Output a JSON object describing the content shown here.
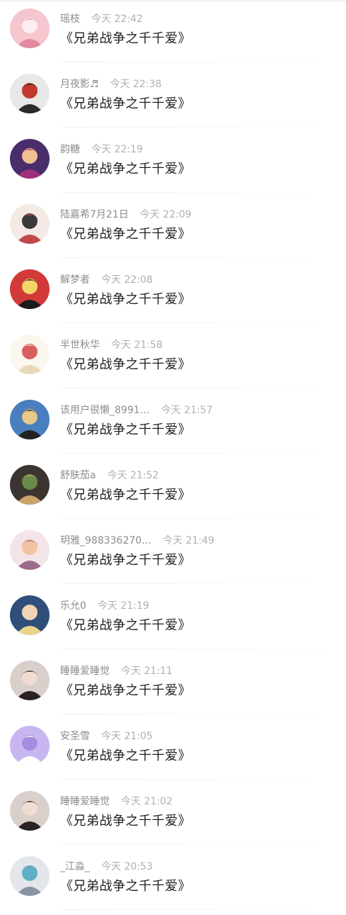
{
  "comments": [
    {
      "user": "瑶枝",
      "time": "今天 22:42",
      "text": "《兄弟战争之千千爱》",
      "avatar": "anime-girl-pink-hair-avatar",
      "colors": [
        "#f6c6cf",
        "#e08aa0",
        "#fdeef1"
      ]
    },
    {
      "user": "月夜影♬",
      "time": "今天 22:38",
      "text": "《兄弟战争之千千爱》",
      "avatar": "anime-boy-white-hair-avatar",
      "colors": [
        "#e8e8e8",
        "#2b2b2b",
        "#c0392b"
      ]
    },
    {
      "user": "韵糖",
      "time": "今天 22:19",
      "text": "《兄弟战争之千千爱》",
      "avatar": "girl-purple-background-avatar",
      "colors": [
        "#4a2d6b",
        "#a0307a",
        "#f0c090"
      ]
    },
    {
      "user": "陆嘉希7月21日",
      "time": "今天 22:09",
      "text": "《兄弟战争之千千爱》",
      "avatar": "anime-pair-avatar",
      "colors": [
        "#f4e9e4",
        "#c04a4a",
        "#3a3a3a"
      ]
    },
    {
      "user": "解梦者",
      "time": "今天 22:08",
      "text": "《兄弟战争之千千爱》",
      "avatar": "black-cat-red-background-avatar",
      "colors": [
        "#d23a3a",
        "#1a1a1a",
        "#f5d56a"
      ]
    },
    {
      "user": "半世秋华",
      "time": "今天 21:58",
      "text": "《兄弟战争之千千爱》",
      "avatar": "cartoon-dog-avatar",
      "colors": [
        "#fbf7ef",
        "#e9d8b9",
        "#d96060"
      ]
    },
    {
      "user": "该用户很懒_8991…",
      "time": "今天 21:57",
      "text": "《兄弟战争之千千爱》",
      "avatar": "girl-blue-sky-avatar",
      "colors": [
        "#4a7fbf",
        "#222222",
        "#e6c88a"
      ]
    },
    {
      "user": "舒肤茄a",
      "time": "今天 21:52",
      "text": "《兄弟战争之千千爱》",
      "avatar": "cartoon-boy-dark-avatar",
      "colors": [
        "#3b3430",
        "#c9a36a",
        "#6a8b4a"
      ]
    },
    {
      "user": "玥雅_988336270…",
      "time": "今天 21:49",
      "text": "《兄弟战争之千千爱》",
      "avatar": "anime-girl-flowers-avatar",
      "colors": [
        "#f3e4e8",
        "#9b6b8a",
        "#f2c3a0"
      ]
    },
    {
      "user": "乐允0",
      "time": "今天 21:19",
      "text": "《兄弟战争之千千爱》",
      "avatar": "girl-yellow-dress-avatar",
      "colors": [
        "#2f4f7a",
        "#e9d48a",
        "#f3d3b8"
      ]
    },
    {
      "user": "睡睡爱睡觉",
      "time": "今天 21:11",
      "text": "《兄弟战争之千千爱》",
      "avatar": "girl-hand-face-avatar",
      "colors": [
        "#d9d0cc",
        "#2a2222",
        "#f0dcd2"
      ]
    },
    {
      "user": "安圣雪",
      "time": "今天 21:05",
      "text": "《兄弟战争之千千爱》",
      "avatar": "purple-chat-bubble-avatar",
      "colors": [
        "#c8b6f0",
        "#ffffff",
        "#a58de0"
      ]
    },
    {
      "user": "睡睡爱睡觉",
      "time": "今天 21:02",
      "text": "《兄弟战争之千千爱》",
      "avatar": "girl-hand-face-avatar",
      "colors": [
        "#d9d0cc",
        "#2a2222",
        "#f0dcd2"
      ]
    },
    {
      "user": "_江淼_",
      "time": "今天 20:53",
      "text": "《兄弟战争之千千爱》",
      "avatar": "anime-girl-silver-hair-avatar",
      "colors": [
        "#e3e6ea",
        "#8a94a3",
        "#5fb0c7"
      ]
    }
  ]
}
